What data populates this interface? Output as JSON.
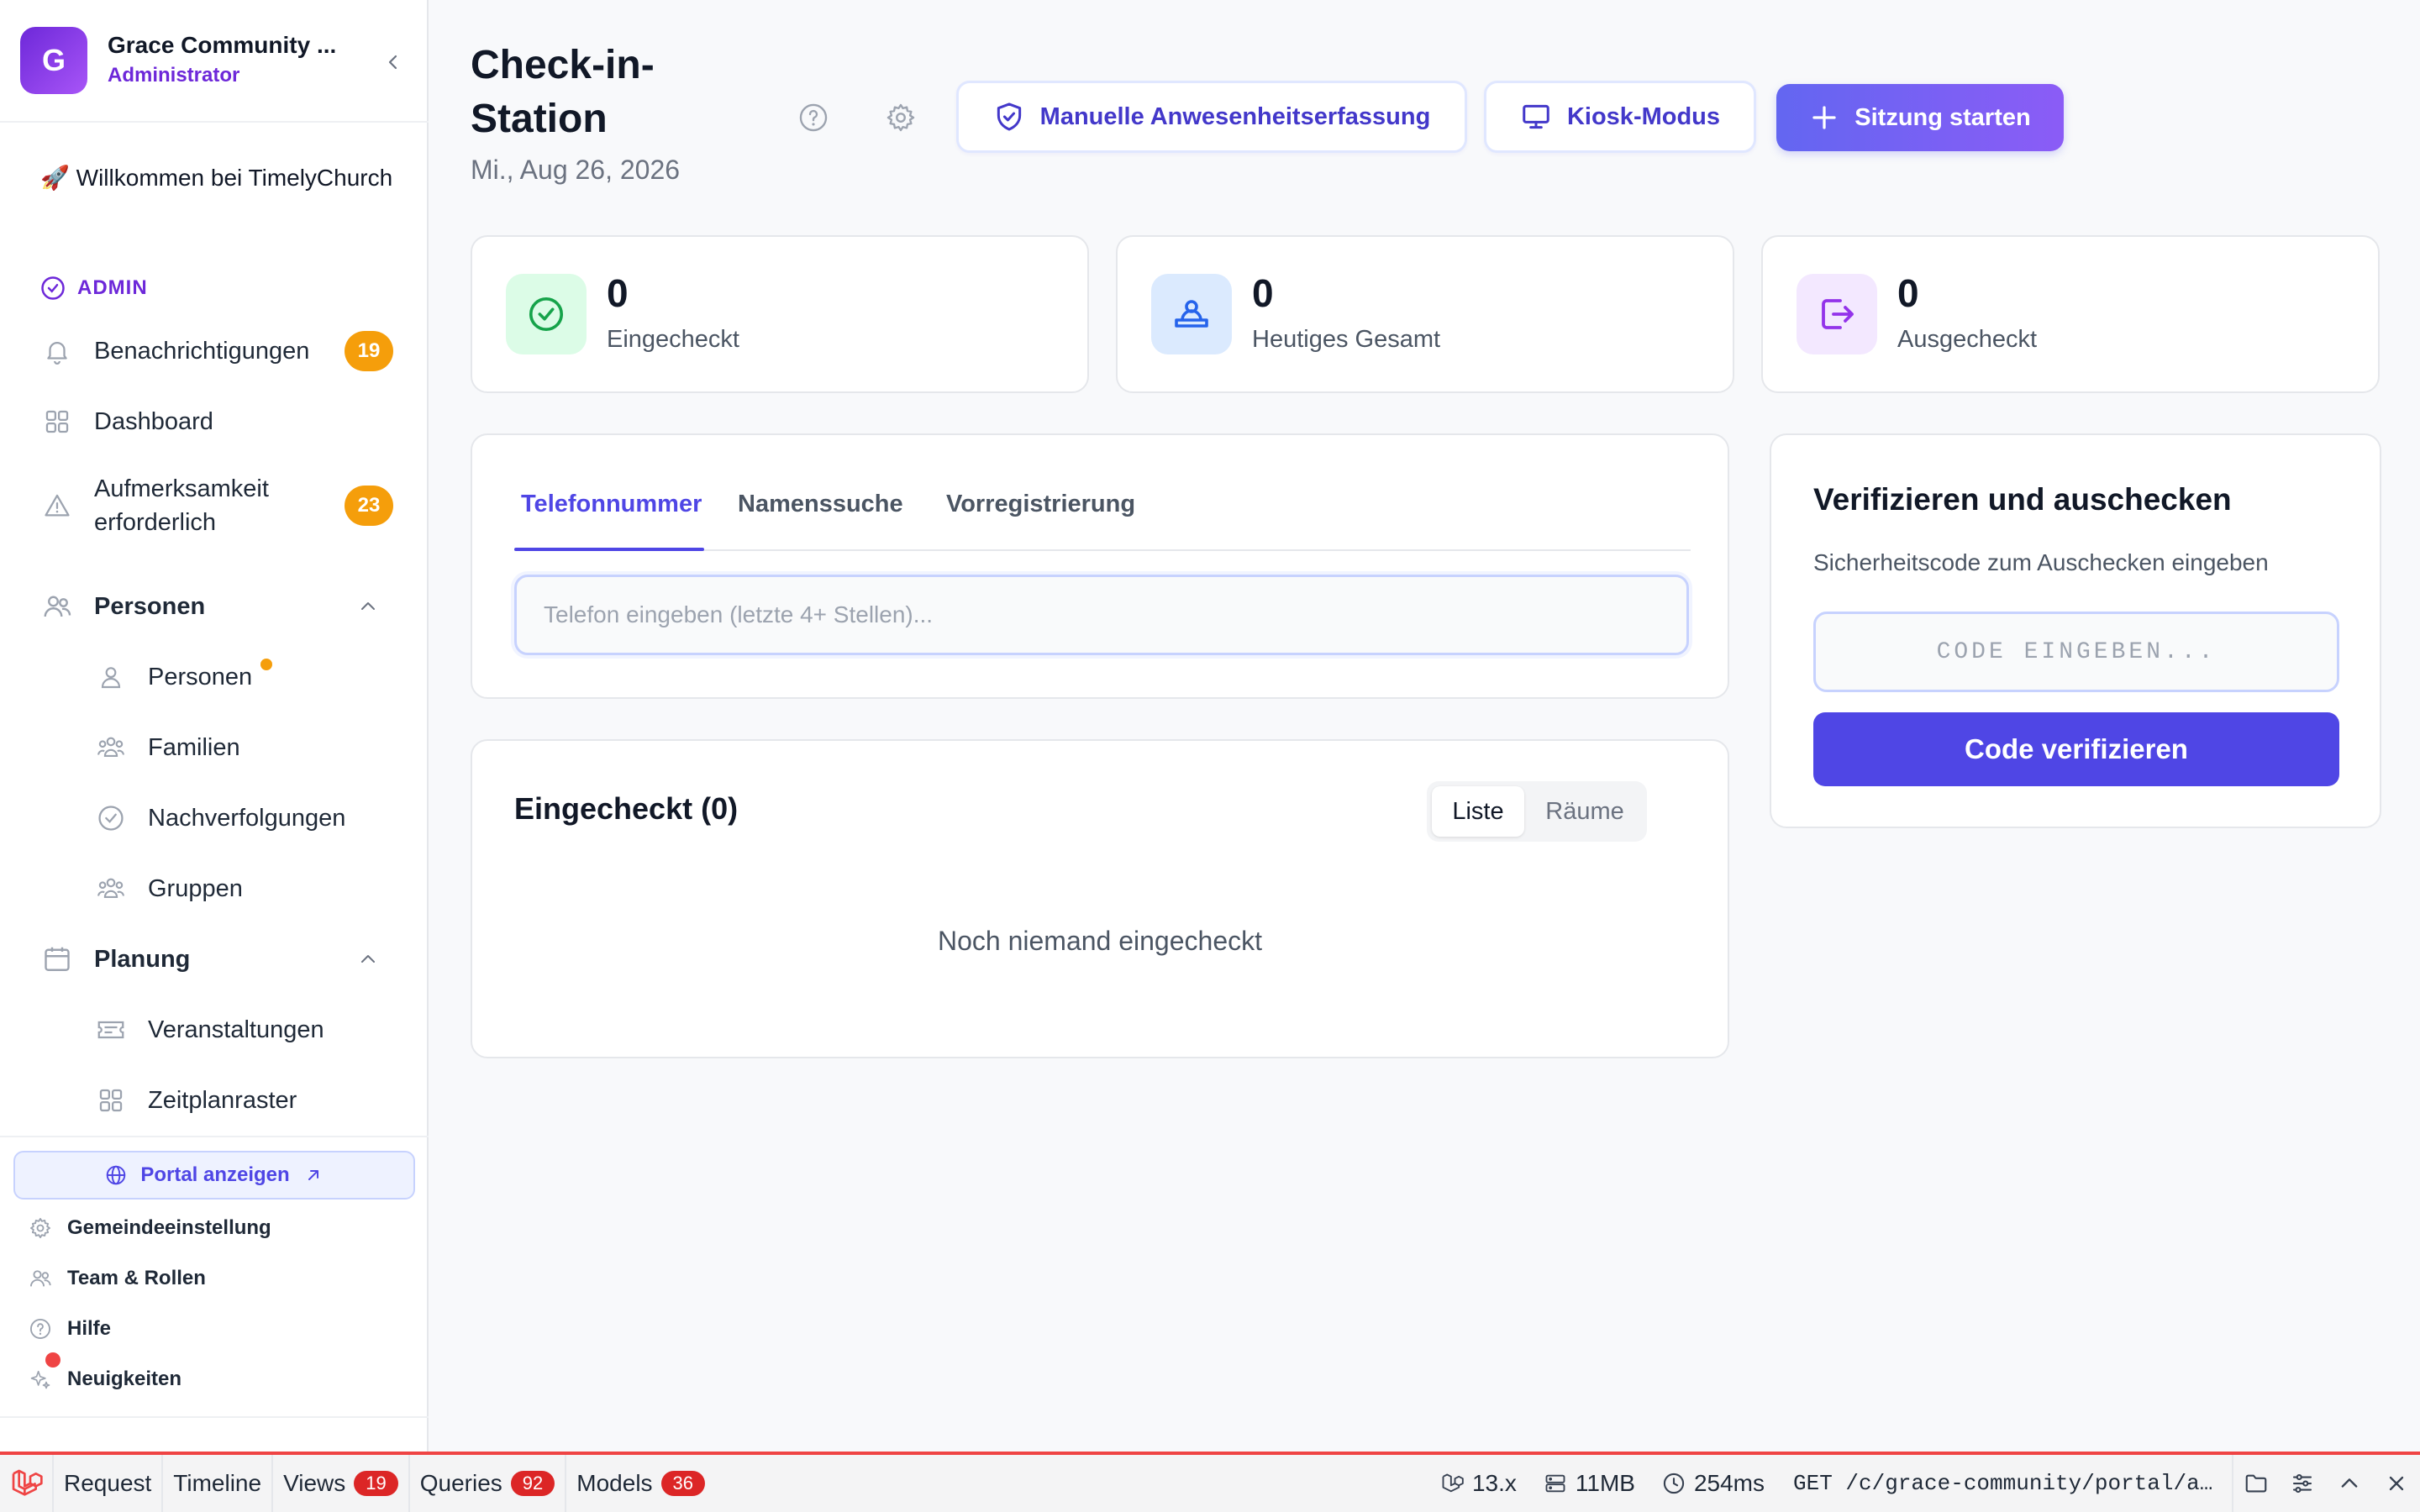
{
  "sidebar": {
    "org_name": "Grace Community ...",
    "org_initial": "G",
    "role": "Administrator",
    "welcome_emoji": "🚀",
    "welcome": "Willkommen bei TimelyChurch",
    "section_label": "ADMIN",
    "items": {
      "notifications": {
        "label": "Benachrichtigungen",
        "badge": "19"
      },
      "dashboard": {
        "label": "Dashboard"
      },
      "attention": {
        "label": "Aufmerksamkeit erforderlich",
        "badge": "23"
      },
      "people_group": {
        "label": "Personen"
      },
      "people": {
        "label": "Personen"
      },
      "families": {
        "label": "Familien"
      },
      "followups": {
        "label": "Nachverfolgungen"
      },
      "groups": {
        "label": "Gruppen"
      },
      "planning_group": {
        "label": "Planung"
      },
      "events": {
        "label": "Veranstaltungen"
      },
      "schedule": {
        "label": "Zeitplanraster"
      }
    },
    "portal_button": "Portal anzeigen",
    "footer": {
      "settings": "Gemeindeeinstellung",
      "team": "Team & Rollen",
      "help": "Hilfe",
      "news": "Neuigkeiten"
    }
  },
  "header": {
    "title": "Check-in-Station",
    "date": "Mi., Aug 26, 2026",
    "manual_button": "Manuelle Anwesenheitserfassung",
    "kiosk_button": "Kiosk-Modus",
    "start_button": "Sitzung starten"
  },
  "stats": [
    {
      "value": "0",
      "label": "Eingecheckt"
    },
    {
      "value": "0",
      "label": "Heutiges Gesamt"
    },
    {
      "value": "0",
      "label": "Ausgecheckt"
    }
  ],
  "search": {
    "tabs": [
      "Telefonnummer",
      "Namenssuche",
      "Vorregistrierung"
    ],
    "active_tab": "Telefonnummer",
    "placeholder": "Telefon eingeben (letzte 4+ Stellen)...",
    "value": ""
  },
  "checked_in": {
    "title": "Eingecheckt (0)",
    "toggle": [
      "Liste",
      "Räume"
    ],
    "active_toggle": "Liste",
    "empty": "Noch niemand eingecheckt"
  },
  "verify": {
    "title": "Verifizieren und auschecken",
    "subtitle": "Sicherheitscode zum Auschecken eingeben",
    "placeholder": "CODE EINGEBEN...",
    "button": "Code verifizieren"
  },
  "debugbar": {
    "tabs": [
      {
        "label": "Request"
      },
      {
        "label": "Timeline"
      },
      {
        "label": "Views",
        "count": "19"
      },
      {
        "label": "Queries",
        "count": "92"
      },
      {
        "label": "Models",
        "count": "36"
      }
    ],
    "version": "13.x",
    "memory": "11MB",
    "time": "254ms",
    "request": "GET /c/grace-community/portal/adm…"
  },
  "colors": {
    "accent": "#4f46e5",
    "brand_purple": "#6d28d9",
    "badge_orange": "#f59e0b",
    "debug_red": "#ef4444"
  }
}
